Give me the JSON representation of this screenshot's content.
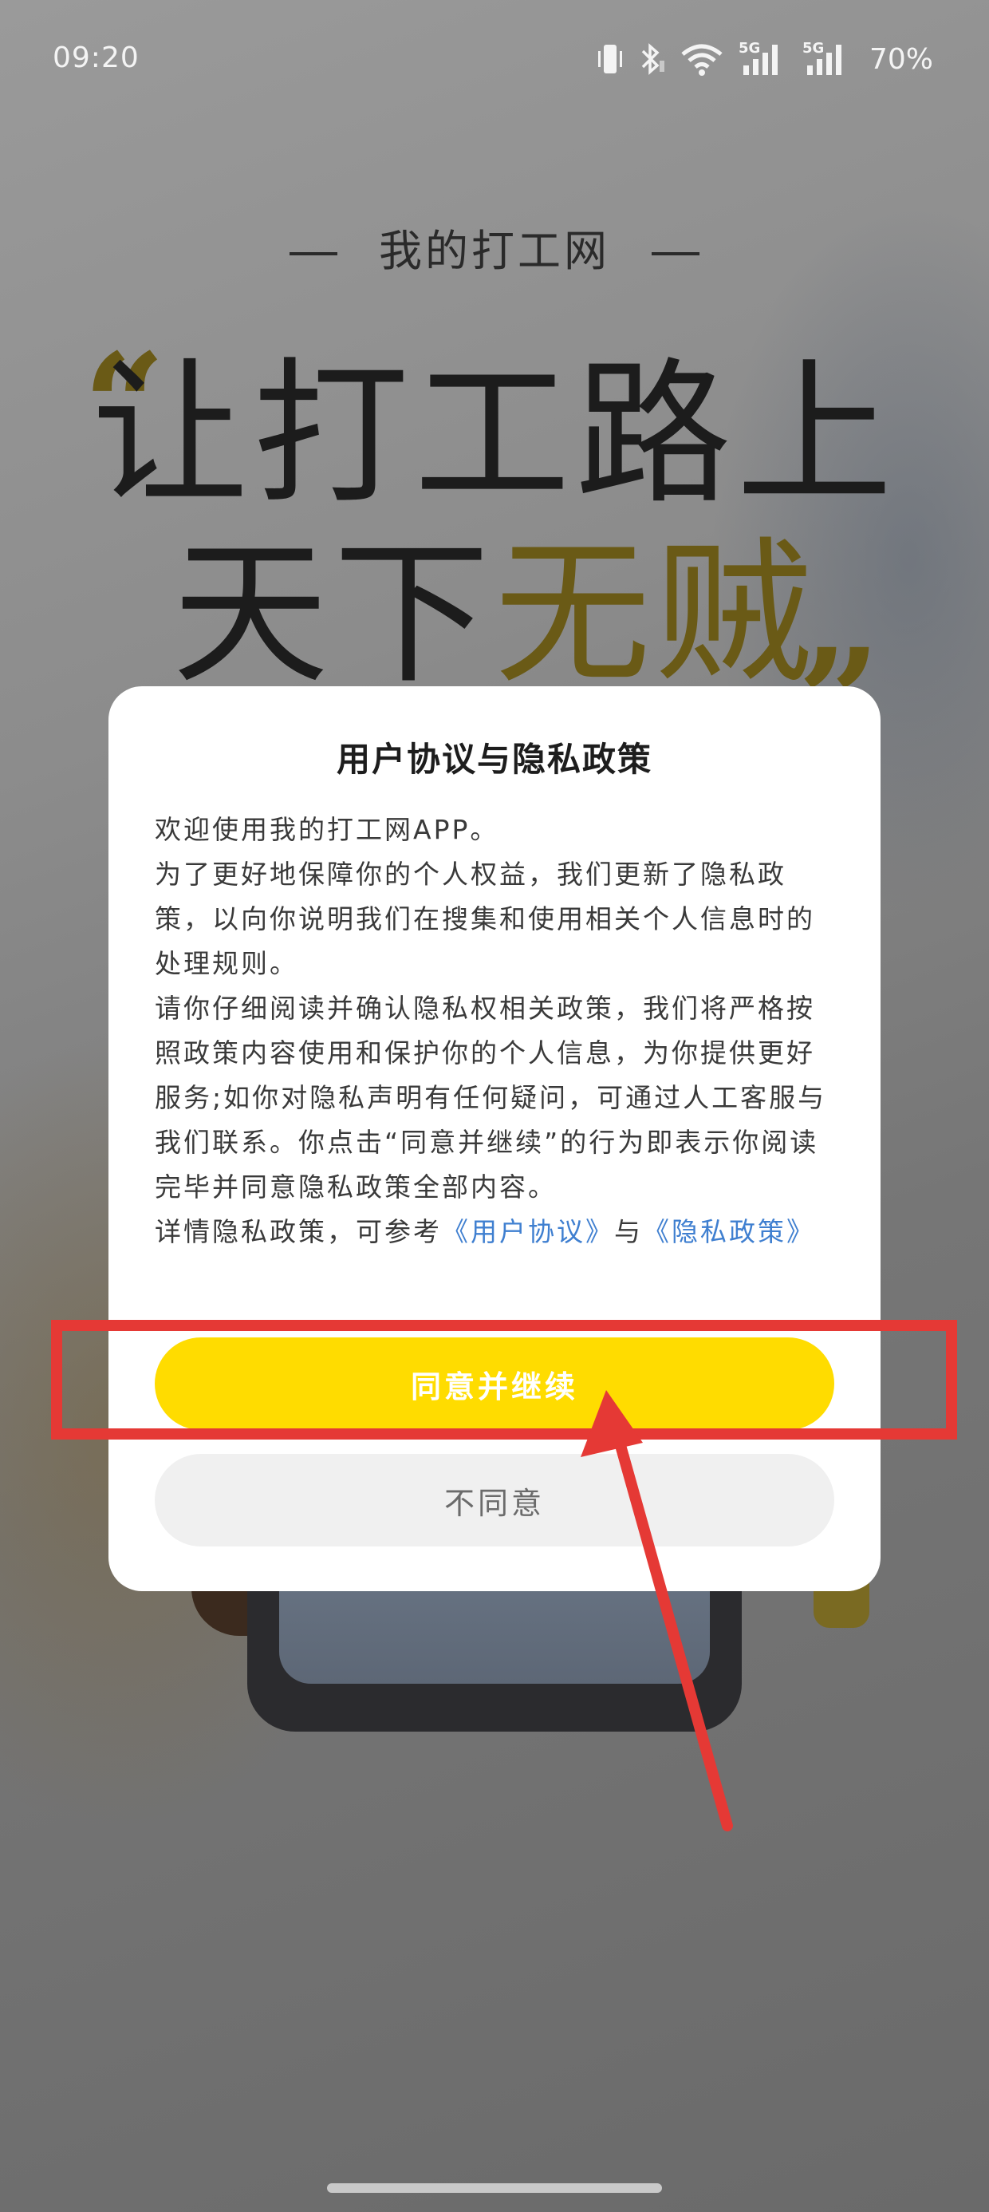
{
  "status_bar": {
    "time": "09:20",
    "battery": "70%",
    "icons": [
      "vibrate-icon",
      "bluetooth-icon",
      "wifi-icon",
      "5g-signal-icon",
      "5g-signal-icon",
      "battery-icon"
    ]
  },
  "splash": {
    "brand": "我的打工网",
    "slogan_line1": "让打工路上",
    "slogan_line2_prefix": "天下",
    "slogan_line2_highlight": "无贼",
    "quote_open": "“",
    "quote_close": "”"
  },
  "dialog": {
    "title": "用户协议与隐私政策",
    "paragraphs": [
      "欢迎使用我的打工网APP。",
      "为了更好地保障你的个人权益，我们更新了隐私政策，以向你说明我们在搜集和使用相关个人信息时的处理规则。",
      "请你仔细阅读并确认隐私权相关政策，我们将严格按照政策内容使用和保护你的个人信息，为你提供更好服务;如你对隐私声明有任何疑问，可通过人工客服与我们联系。你点击“同意并继续”的行为即表示你阅读完毕并同意隐私政策全部内容。"
    ],
    "details_prefix": "详情隐私政策，可参考",
    "user_agreement_link": "《用户协议》",
    "details_conjunction": "与",
    "privacy_policy_link": "《隐私政策》",
    "agree_button": "同意并继续",
    "disagree_button": "不同意"
  },
  "colors": {
    "accent": "#ffdc00",
    "link": "#3f7fd0",
    "annotation": "#e53935"
  }
}
